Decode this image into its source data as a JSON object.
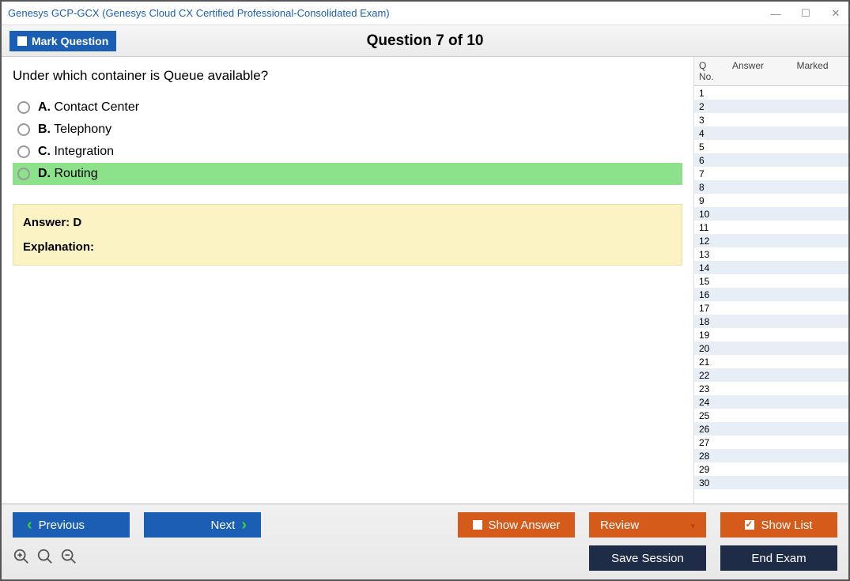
{
  "window": {
    "title": "Genesys GCP-GCX (Genesys Cloud CX Certified Professional-Consolidated Exam)"
  },
  "topbar": {
    "mark_label": "Mark Question",
    "question_title": "Question 7 of 10"
  },
  "question": {
    "text": "Under which container is Queue available?",
    "options": [
      {
        "letter": "A.",
        "text": "Contact Center",
        "selected": false
      },
      {
        "letter": "B.",
        "text": "Telephony",
        "selected": false
      },
      {
        "letter": "C.",
        "text": "Integration",
        "selected": false
      },
      {
        "letter": "D.",
        "text": "Routing",
        "selected": true
      }
    ]
  },
  "answer_box": {
    "answer_label": "Answer: D",
    "explanation_label": "Explanation:"
  },
  "side": {
    "headers": {
      "qno": "Q No.",
      "answer": "Answer",
      "marked": "Marked"
    },
    "rows": [
      {
        "n": "1"
      },
      {
        "n": "2"
      },
      {
        "n": "3"
      },
      {
        "n": "4"
      },
      {
        "n": "5"
      },
      {
        "n": "6"
      },
      {
        "n": "7"
      },
      {
        "n": "8"
      },
      {
        "n": "9"
      },
      {
        "n": "10"
      },
      {
        "n": "11"
      },
      {
        "n": "12"
      },
      {
        "n": "13"
      },
      {
        "n": "14"
      },
      {
        "n": "15"
      },
      {
        "n": "16"
      },
      {
        "n": "17"
      },
      {
        "n": "18"
      },
      {
        "n": "19"
      },
      {
        "n": "20"
      },
      {
        "n": "21"
      },
      {
        "n": "22"
      },
      {
        "n": "23"
      },
      {
        "n": "24"
      },
      {
        "n": "25"
      },
      {
        "n": "26"
      },
      {
        "n": "27"
      },
      {
        "n": "28"
      },
      {
        "n": "29"
      },
      {
        "n": "30"
      }
    ]
  },
  "buttons": {
    "previous": "Previous",
    "next": "Next",
    "show_answer": "Show Answer",
    "review": "Review",
    "show_list": "Show List",
    "save_session": "Save Session",
    "end_exam": "End Exam"
  }
}
